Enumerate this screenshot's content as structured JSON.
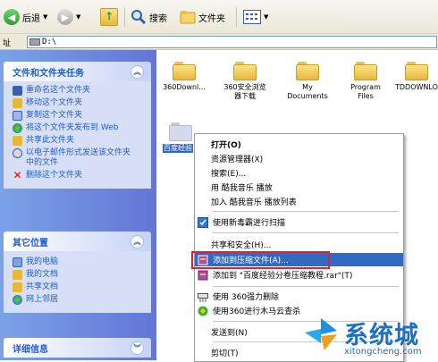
{
  "toolbar": {
    "back_label": "后退",
    "search_label": "搜索",
    "folders_label": "文件夹"
  },
  "address": {
    "label": "址",
    "path": "D:\\"
  },
  "left_panel": {
    "tasks": {
      "title": "文件和文件夹任务",
      "items": [
        {
          "label": "重命名这个文件夹",
          "icon": "rename-icon"
        },
        {
          "label": "移动这个文件夹",
          "icon": "move-icon"
        },
        {
          "label": "复制这个文件夹",
          "icon": "copy-icon"
        },
        {
          "label": "将这个文件夹发布到 Web",
          "icon": "publish-web-icon"
        },
        {
          "label": "共享此文件夹",
          "icon": "share-icon"
        },
        {
          "label": "以电子邮件形式发送该文件夹中的文件",
          "icon": "email-icon"
        },
        {
          "label": "删除这个文件夹",
          "icon": "delete-icon"
        }
      ]
    },
    "other_places": {
      "title": "其它位置",
      "items": [
        {
          "label": "我的电脑",
          "icon": "my-computer-icon"
        },
        {
          "label": "我的文档",
          "icon": "my-documents-icon"
        },
        {
          "label": "共享文档",
          "icon": "shared-documents-icon"
        },
        {
          "label": "网上邻居",
          "icon": "network-icon"
        }
      ]
    },
    "details": {
      "title": "详细信息"
    }
  },
  "files": [
    {
      "name": "360Downl..."
    },
    {
      "name": "360安全浏览器下载"
    },
    {
      "name": "My Documents"
    },
    {
      "name": "Program Files"
    },
    {
      "name": "TDDOWNLO"
    },
    {
      "name": "百度经验"
    }
  ],
  "context_menu": {
    "items": [
      {
        "label": "打开(O)"
      },
      {
        "label": "资源管理器(X)"
      },
      {
        "label": "搜索(E)..."
      },
      {
        "label": "用 酷我音乐 播放"
      },
      {
        "label": "加入 酷我音乐 播放列表"
      },
      {
        "label": "使用新毒霸进行扫描"
      },
      {
        "label": "共享和安全(H)..."
      },
      {
        "label": "添加到压缩文件(A)..."
      },
      {
        "label": "添加到 \"百度经验分卷压缩教程.rar\"(T)"
      },
      {
        "label": "使用 360强力删除"
      },
      {
        "label": "使用360进行木马云查杀"
      },
      {
        "label": "发送到(N)"
      },
      {
        "label": "剪切(T)"
      }
    ],
    "highlight_color": "#316ac5",
    "callout_color": "#d0283a"
  },
  "watermark": {
    "title": "系统城",
    "url": "xitongcheng.com"
  }
}
